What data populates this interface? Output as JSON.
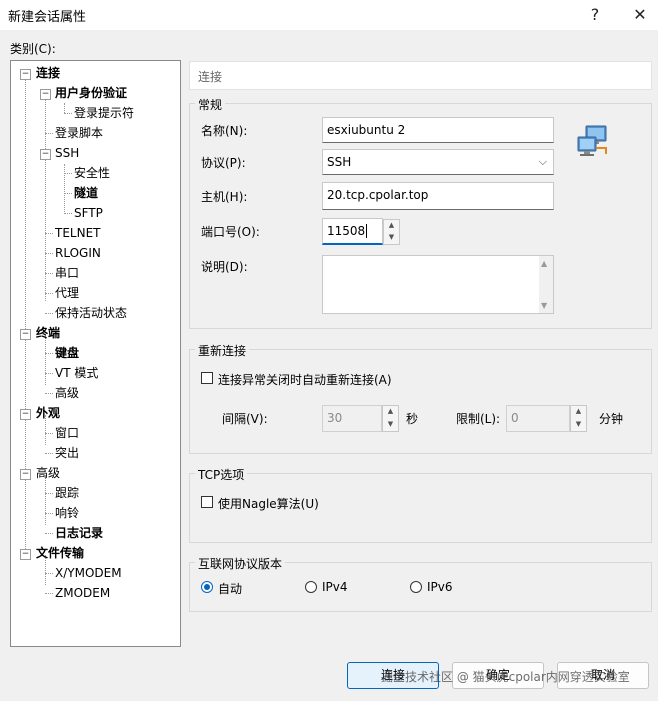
{
  "window": {
    "title": "新建会话属性",
    "help_glyph": "?",
    "close_glyph": "✕"
  },
  "category_label": "类别(C):",
  "tree": {
    "connection": "连接",
    "auth": "用户身份验证",
    "login_prompt": "登录提示符",
    "login_script": "登录脚本",
    "ssh": "SSH",
    "security": "安全性",
    "tunnel": "隧道",
    "sftp": "SFTP",
    "telnet": "TELNET",
    "rlogin": "RLOGIN",
    "serial": "串口",
    "proxy": "代理",
    "keepalive": "保持活动状态",
    "terminal": "终端",
    "keyboard": "键盘",
    "vt_mode": "VT 模式",
    "advanced_term": "高级",
    "appearance": "外观",
    "window": "窗口",
    "highlight": "突出",
    "advanced": "高级",
    "trace": "跟踪",
    "bell": "响铃",
    "logging": "日志记录",
    "file_transfer": "文件传输",
    "xymodem": "X/YMODEM",
    "zmodem": "ZMODEM"
  },
  "header": "连接",
  "general": {
    "title": "常规",
    "name_label": "名称(N):",
    "name_value": "esxiubuntu 2",
    "protocol_label": "协议(P):",
    "protocol_value": "SSH",
    "host_label": "主机(H):",
    "host_value": "20.tcp.cpolar.top",
    "port_label": "端口号(O):",
    "port_value": "11508",
    "desc_label": "说明(D):",
    "desc_value": ""
  },
  "reconnect": {
    "title": "重新连接",
    "auto_label": "连接异常关闭时自动重新连接(A)",
    "interval_label": "间隔(V):",
    "interval_value": "30",
    "seconds_unit": "秒",
    "limit_label": "限制(L):",
    "limit_value": "0",
    "minutes_unit": "分钟"
  },
  "tcp": {
    "title": "TCP选项",
    "nagle_label": "使用Nagle算法(U)"
  },
  "ipver": {
    "title": "互联网协议版本",
    "auto": "自动",
    "ipv4": "IPv4",
    "ipv6": "IPv6",
    "selected": "auto"
  },
  "buttons": {
    "connect": "连接",
    "ok": "确定",
    "cancel": "取消"
  },
  "watermark": "掘金技术社区 @ 猫头虎cpolar内网穿透实验室",
  "colors": {
    "accent": "#0067c0",
    "window_bg": "#f0f0f0"
  }
}
